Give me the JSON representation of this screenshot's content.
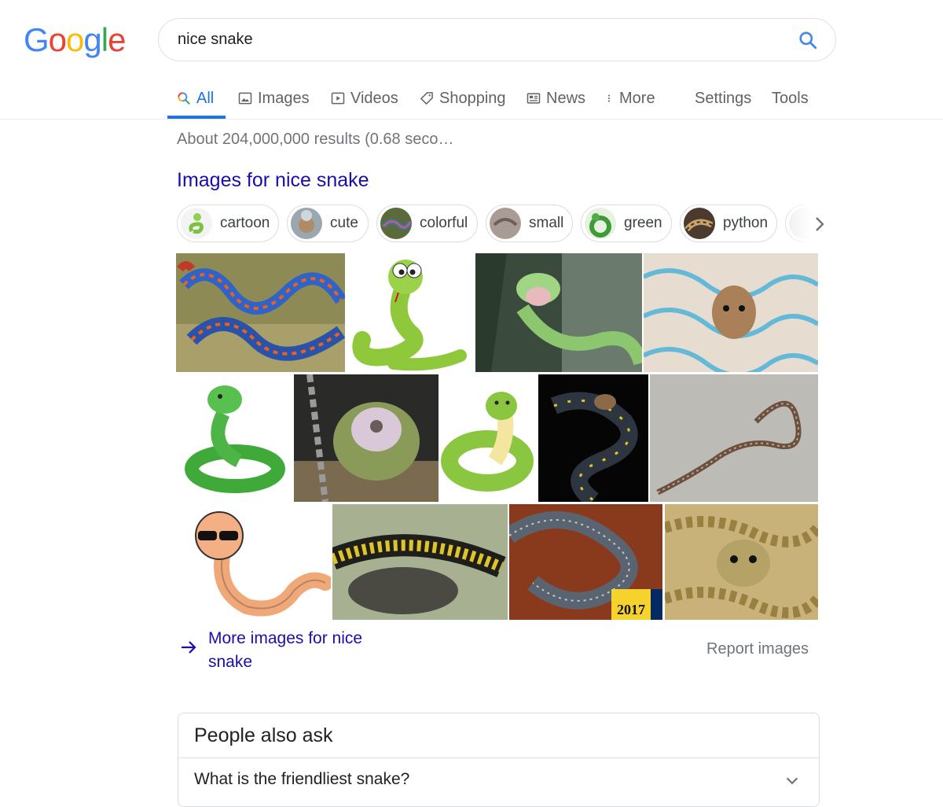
{
  "logo": {
    "letters": [
      "G",
      "o",
      "o",
      "g",
      "l",
      "e"
    ],
    "colors": [
      "#4285f4",
      "#ea4335",
      "#fbbc05",
      "#4285f4",
      "#34a853",
      "#ea4335"
    ]
  },
  "search": {
    "value": "nice snake",
    "placeholder": ""
  },
  "tabs": [
    {
      "label": "All",
      "icon": "search-icon",
      "active": true
    },
    {
      "label": "Images",
      "icon": "image-icon"
    },
    {
      "label": "Videos",
      "icon": "video-icon"
    },
    {
      "label": "Shopping",
      "icon": "tag-icon"
    },
    {
      "label": "News",
      "icon": "news-icon"
    },
    {
      "label": "More",
      "icon": "more-vert-icon"
    },
    {
      "label": "Settings"
    },
    {
      "label": "Tools"
    }
  ],
  "result_stats": "About 204,000,000 results (0.68 seco…",
  "images_section": {
    "heading": "Images for nice snake",
    "chips": [
      "cartoon",
      "cute",
      "colorful",
      "small",
      "green",
      "python"
    ],
    "more_link": "More images for nice snake",
    "report": "Report images",
    "overlay_badge": "2017"
  },
  "people_also_ask": {
    "title": "People also ask",
    "questions": [
      "What is the friendliest snake?"
    ]
  },
  "colors": {
    "accent": "#1a73e8",
    "link": "#1a0dab",
    "muted": "#70757a"
  }
}
